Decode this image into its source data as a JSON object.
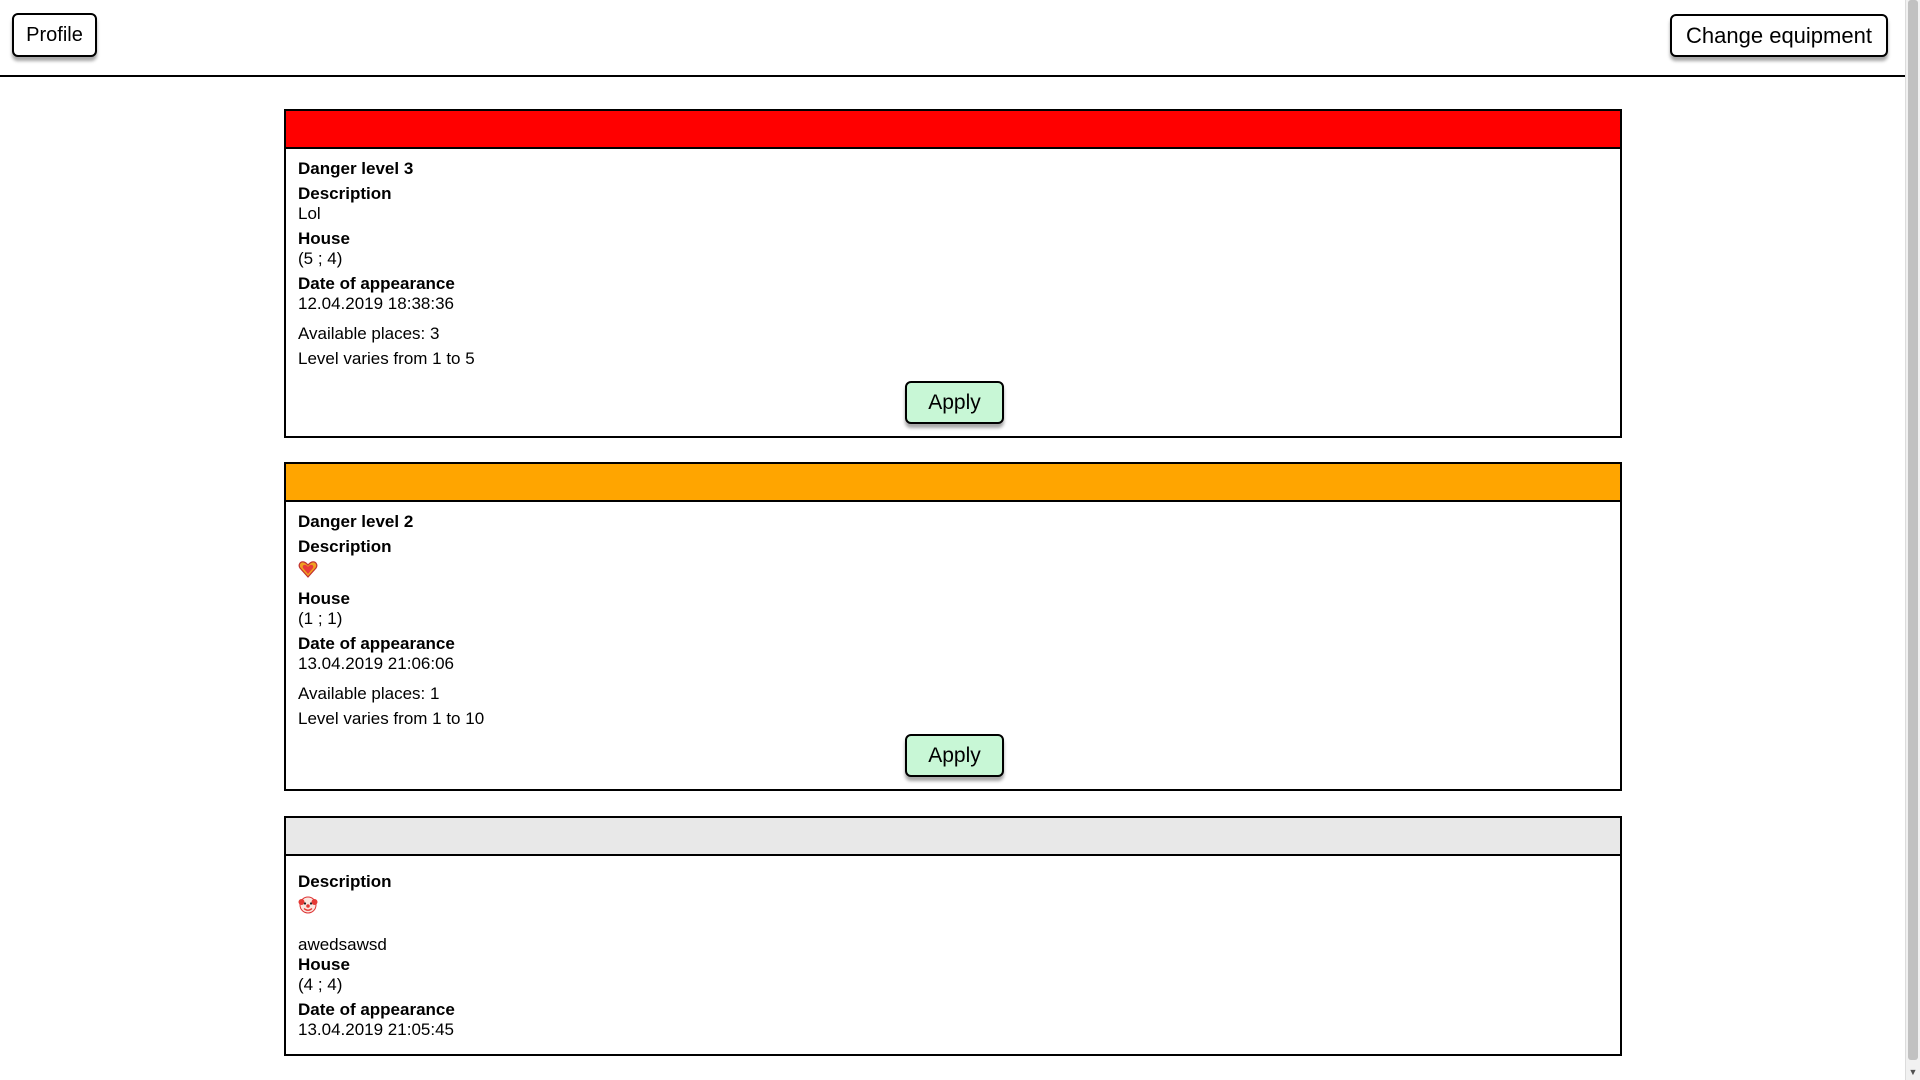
{
  "topbar": {
    "profile_label": "Profile",
    "change_equipment_label": "Change equipment"
  },
  "cards": [
    {
      "header_color": "#ff0000",
      "danger_level": "Danger level 3",
      "description_label": "Description",
      "description": "Lol",
      "house_label": "House",
      "house": "(5 ; 4)",
      "date_label": "Date of appearance",
      "date": "12.04.2019 18:38:36",
      "available_places": "Available places: 3",
      "level_range": "Level varies from 1 to 5",
      "apply_label": "Apply"
    },
    {
      "header_color": "#ffa500",
      "danger_level": "Danger level 2",
      "description_label": "Description",
      "description_icon": "heart-emoji-icon",
      "house_label": "House",
      "house": "(1 ; 1)",
      "date_label": "Date of appearance",
      "date": "13.04.2019 21:06:06",
      "available_places": "Available places: 1",
      "level_range": "Level varies from 1 to 10",
      "apply_label": "Apply"
    },
    {
      "header_color": "#e8e8e8",
      "description_label": "Description",
      "description_icon": "clown-emoji-icon",
      "description_extra": "awedsawsd",
      "house_label": "House",
      "house": "(4 ; 4)",
      "date_label": "Date of appearance",
      "date": "13.04.2019 21:05:45"
    }
  ]
}
